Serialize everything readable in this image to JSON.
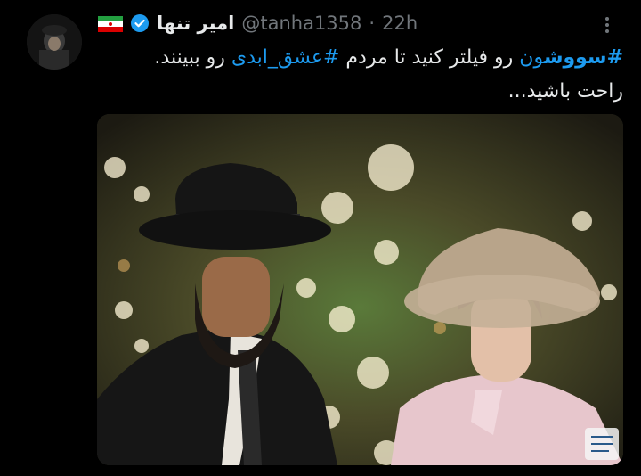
{
  "tweet": {
    "author_name": "امیر تنها",
    "handle": "@tanha1358",
    "separator": "·",
    "time": "22h",
    "flag_icon": "iran-flag-icon",
    "verified_icon": "verified-badge-icon",
    "more_icon": "more-options-icon",
    "text": {
      "hashtag_1_bold": "#سووش",
      "hashtag_1_rest": "ون",
      "part_1": " رو فیلتر کنید تا مردم ",
      "hashtag_2": "#عشق_ابدی",
      "part_2": " رو ببینند.",
      "line_2": "راحت باشید..."
    }
  },
  "colors": {
    "background": "#000000",
    "text": "#e7e9ea",
    "muted": "#71767b",
    "link": "#1d9bf0"
  }
}
